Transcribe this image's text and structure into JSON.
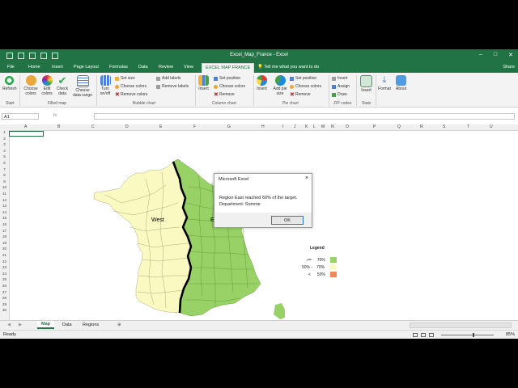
{
  "window": {
    "title": "Excel_Map_France - Excel",
    "controls": [
      "–",
      "□",
      "✕"
    ]
  },
  "tabs": [
    "File",
    "Home",
    "Insert",
    "Page Layout",
    "Formulas",
    "Data",
    "Review",
    "View",
    "EXCEL MAP FRANCE"
  ],
  "tell_me": "Tell me what you want to do",
  "share": "Share",
  "ribbon": {
    "refresh": "Refresh",
    "choose_colors": "Choose colors",
    "edit_colors": "Edit colors",
    "check_data": "Check data",
    "choose_data_range": "Choose data range",
    "turn_onoff": "Turn on/off",
    "set_size": "Set size",
    "choose_colors_small": "Choose colors",
    "remove_colors": "Remove colors",
    "add_labels": "Add labels",
    "remove_labels": "Remove labels",
    "insert": "Insert",
    "set_position": "Set position",
    "remove": "Remove",
    "add_pie_size": "Add pie size",
    "assign": "Assign",
    "draw": "Draw",
    "format": "Format",
    "about": "About",
    "groups": {
      "start": "Start",
      "filled_map": "Filled map",
      "bubble_chart": "Bubble chart",
      "column_chart": "Column chart",
      "pie_chart": "Pie chart",
      "zip_codes": "ZIP codes",
      "stats": "Stats"
    }
  },
  "formula_bar": {
    "name_box": "A1",
    "fx": "fx",
    "value": ""
  },
  "columns": [
    "A",
    "B",
    "C",
    "D",
    "E",
    "F",
    "G",
    "H",
    "I",
    "J",
    "K",
    "L",
    "M",
    "N",
    "O",
    "P",
    "Q",
    "R",
    "S",
    "T",
    "U"
  ],
  "rows": [
    "1",
    "2",
    "3",
    "4",
    "5",
    "6",
    "7",
    "8",
    "9",
    "10",
    "11",
    "12",
    "13",
    "14",
    "15",
    "16",
    "17",
    "18",
    "19",
    "20",
    "21",
    "22",
    "23",
    "24",
    "25",
    "26",
    "27",
    "28",
    "29",
    "30"
  ],
  "map": {
    "west_label": "West",
    "east_label": "E",
    "west_color": "#fbf9c2",
    "east_color": "#98d266",
    "border_color": "#000000"
  },
  "legend": {
    "title": "Legend",
    "rows": [
      {
        "label": ">=",
        "value": "70%",
        "color": "#98d266"
      },
      {
        "label": "50% -",
        "value": "70%",
        "color": "#fbf9c2"
      },
      {
        "label": "<",
        "value": "50%",
        "color": "#f0885a"
      }
    ]
  },
  "dialog": {
    "title": "Microsoft Excel",
    "line1": "Region East reached 60% of the target.",
    "line2": "Department: Somme",
    "ok": "OK"
  },
  "sheets": [
    "Map",
    "Data",
    "Regions"
  ],
  "active_sheet": "Map",
  "status": {
    "text": "Ready",
    "zoom": "85%"
  },
  "colors": {
    "excel_green": "#217346"
  }
}
